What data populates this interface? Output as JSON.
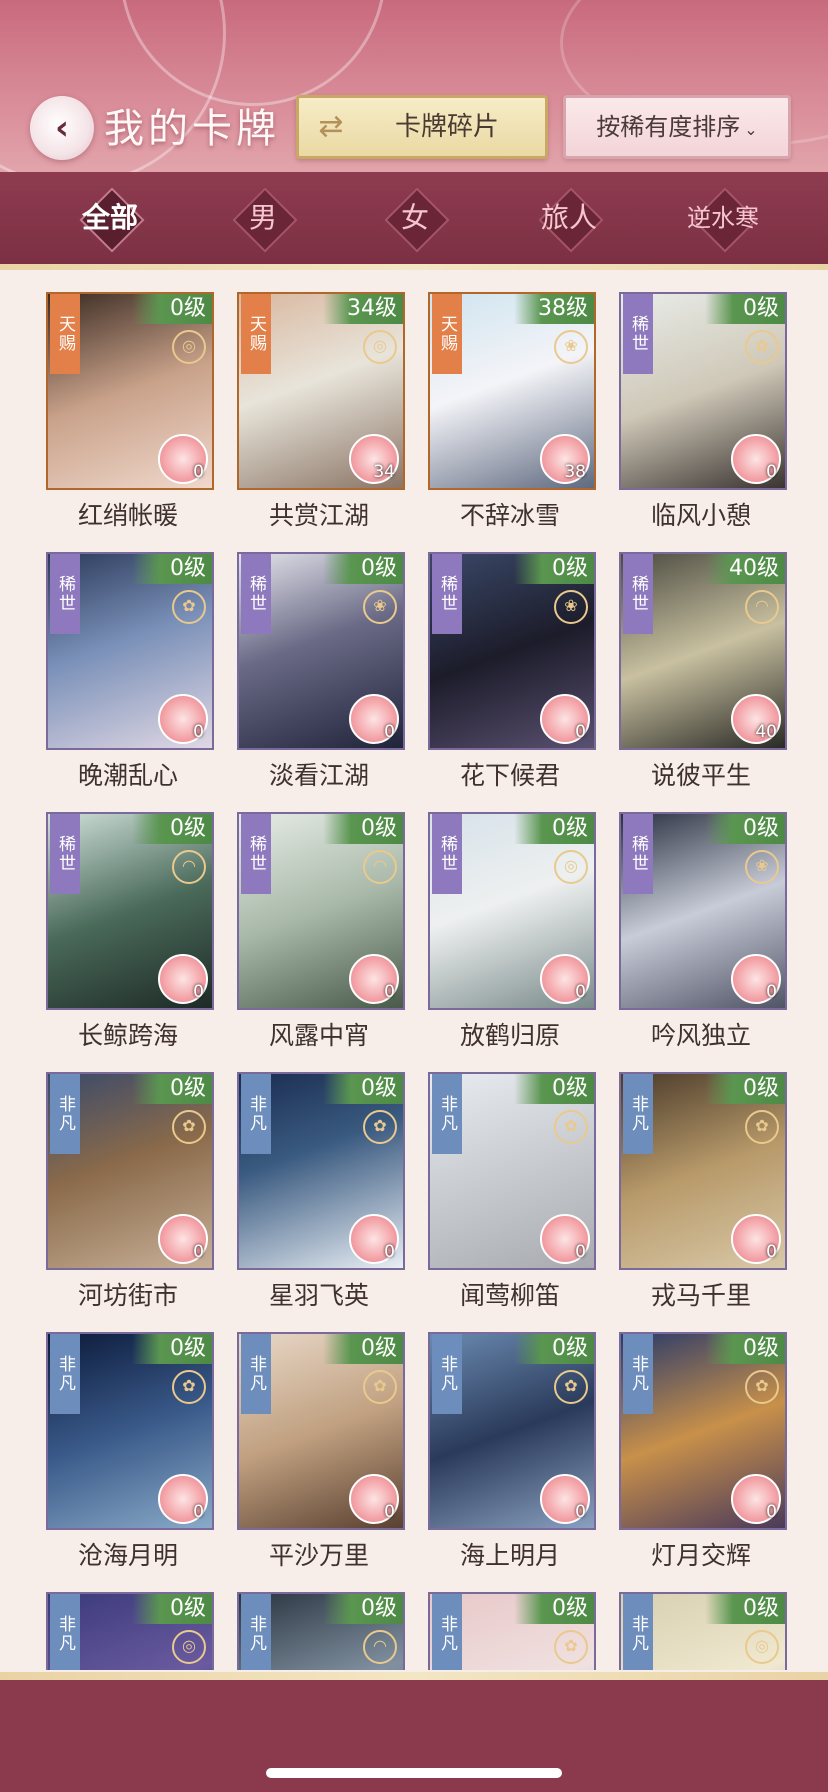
{
  "header": {
    "title": "我的卡牌",
    "fragment_button": "卡牌碎片",
    "sort_button": "按稀有度排序"
  },
  "tabs": [
    "全部",
    "男",
    "女",
    "旅人",
    "逆水寒"
  ],
  "active_tab": "全部",
  "cards": [
    {
      "name": "红绡帐暖",
      "rarity": "天赐",
      "level": "0级",
      "count": "0",
      "badge": "coin-icon"
    },
    {
      "name": "共赏江湖",
      "rarity": "天赐",
      "level": "34级",
      "count": "34",
      "badge": "coin-icon"
    },
    {
      "name": "不辞冰雪",
      "rarity": "天赐",
      "level": "38级",
      "count": "38",
      "badge": "orchid-icon"
    },
    {
      "name": "临风小憩",
      "rarity": "稀世",
      "level": "0级",
      "count": "0",
      "badge": "flower-icon"
    },
    {
      "name": "晚潮乱心",
      "rarity": "稀世",
      "level": "0级",
      "count": "0",
      "badge": "flower-icon"
    },
    {
      "name": "淡看江湖",
      "rarity": "稀世",
      "level": "0级",
      "count": "0",
      "badge": "orchid-icon"
    },
    {
      "name": "花下候君",
      "rarity": "稀世",
      "level": "0级",
      "count": "0",
      "badge": "orchid-icon"
    },
    {
      "name": "说彼平生",
      "rarity": "稀世",
      "level": "40级",
      "count": "40",
      "badge": "fan-icon"
    },
    {
      "name": "长鲸跨海",
      "rarity": "稀世",
      "level": "0级",
      "count": "0",
      "badge": "fan-icon"
    },
    {
      "name": "风露中宵",
      "rarity": "稀世",
      "level": "0级",
      "count": "0",
      "badge": "fan-icon"
    },
    {
      "name": "放鹤归原",
      "rarity": "稀世",
      "level": "0级",
      "count": "0",
      "badge": "coin-icon"
    },
    {
      "name": "吟风独立",
      "rarity": "稀世",
      "level": "0级",
      "count": "0",
      "badge": "orchid-icon"
    },
    {
      "name": "河坊街市",
      "rarity": "非凡",
      "level": "0级",
      "count": "0",
      "badge": "flower-icon"
    },
    {
      "name": "星羽飞英",
      "rarity": "非凡",
      "level": "0级",
      "count": "0",
      "badge": "flower-icon"
    },
    {
      "name": "闻莺柳笛",
      "rarity": "非凡",
      "level": "0级",
      "count": "0",
      "badge": "flower-icon"
    },
    {
      "name": "戎马千里",
      "rarity": "非凡",
      "level": "0级",
      "count": "0",
      "badge": "flower-icon"
    },
    {
      "name": "沧海月明",
      "rarity": "非凡",
      "level": "0级",
      "count": "0",
      "badge": "flower-icon"
    },
    {
      "name": "平沙万里",
      "rarity": "非凡",
      "level": "0级",
      "count": "0",
      "badge": "flower-icon"
    },
    {
      "name": "海上明月",
      "rarity": "非凡",
      "level": "0级",
      "count": "0",
      "badge": "flower-icon"
    },
    {
      "name": "灯月交辉",
      "rarity": "非凡",
      "level": "0级",
      "count": "0",
      "badge": "flower-icon"
    },
    {
      "name": "",
      "rarity": "非凡",
      "level": "0级",
      "count": "",
      "badge": "coin-icon"
    },
    {
      "name": "",
      "rarity": "非凡",
      "level": "0级",
      "count": "",
      "badge": "fan-icon"
    },
    {
      "name": "",
      "rarity": "非凡",
      "level": "0级",
      "count": "",
      "badge": "flower-icon"
    },
    {
      "name": "",
      "rarity": "非凡",
      "level": "0级",
      "count": "",
      "badge": "coin-icon"
    }
  ],
  "colors": {
    "header_pink": "#d88a97",
    "tab_bar": "#8e3b50",
    "gold_trim": "#f3e6c4",
    "level_green": "#5a9650",
    "rarity_tianci": "#e38049",
    "rarity_xishi": "#8e78be",
    "rarity_feifan": "#6d8ebd"
  }
}
